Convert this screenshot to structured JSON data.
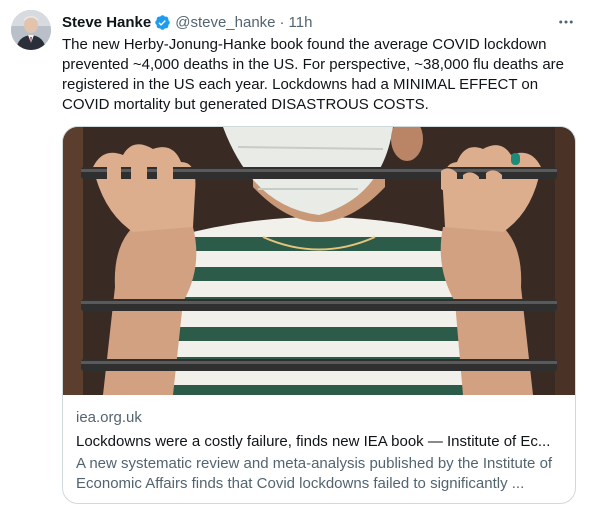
{
  "tweet": {
    "author_name": "Steve Hanke",
    "handle": "@steve_hanke",
    "separator": "·",
    "time": "11h",
    "text": "The new Herby-Jonung-Hanke book found the average COVID lockdown prevented ~4,000 deaths in the US. For perspective, ~38,000 flu deaths are registered in the US each year. Lockdowns had a MINIMAL EFFECT on COVID mortality but generated DISASTROUS COSTS."
  },
  "icons": {
    "verified": "verified-badge-icon",
    "more": "more-options-icon"
  },
  "colors": {
    "verified_blue": "#1d9bf0",
    "text_primary": "#0f1419",
    "text_secondary": "#536471",
    "border": "#cfd9de"
  },
  "card": {
    "domain": "iea.org.uk",
    "title": "Lockdowns were a costly failure, finds new IEA book — Institute of Ec...",
    "description": "A new systematic review and meta-analysis published by the Institute of Economic Affairs finds that Covid lockdowns failed to significantly ..."
  }
}
